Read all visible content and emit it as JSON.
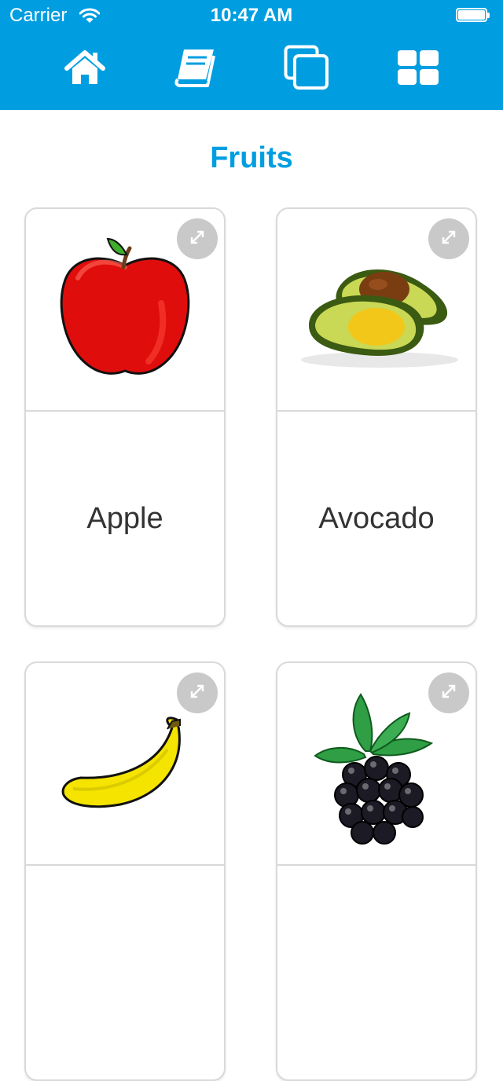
{
  "status_bar": {
    "carrier": "Carrier",
    "time": "10:47 AM"
  },
  "nav": {
    "items": [
      {
        "icon": "home-icon"
      },
      {
        "icon": "book-icon"
      },
      {
        "icon": "cards-icon"
      },
      {
        "icon": "grid-icon"
      }
    ]
  },
  "page": {
    "title": "Fruits"
  },
  "cards": [
    {
      "label": "Apple",
      "image": "apple"
    },
    {
      "label": "Avocado",
      "image": "avocado"
    },
    {
      "label": "",
      "image": "banana"
    },
    {
      "label": "",
      "image": "blackberry"
    }
  ],
  "colors": {
    "accent": "#009ee0",
    "card_border": "#d9d9d9",
    "expand_button": "#c9c9c9",
    "label_text": "#333333"
  }
}
